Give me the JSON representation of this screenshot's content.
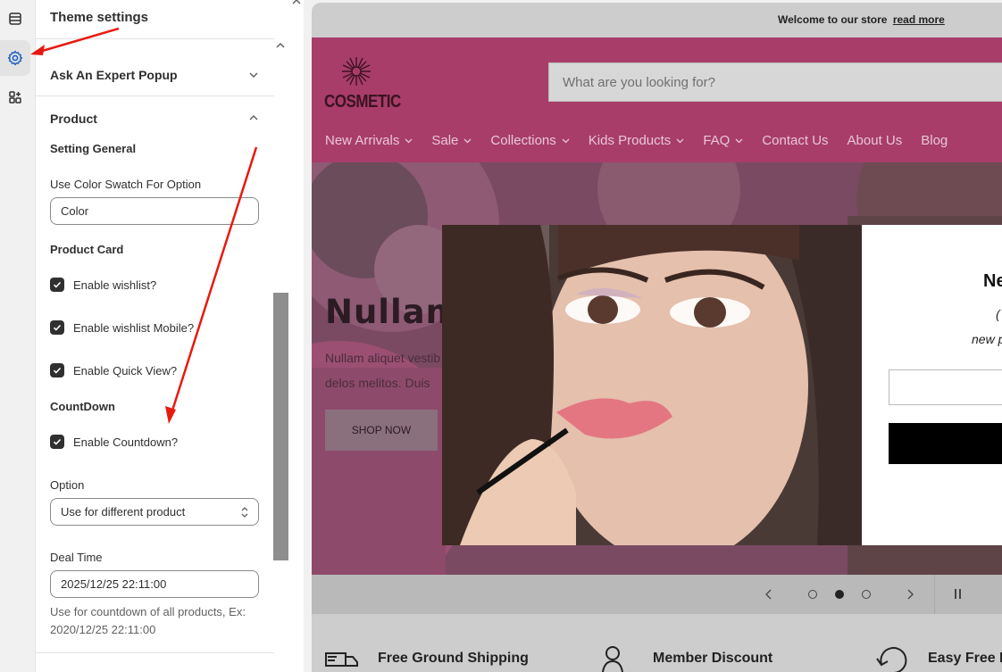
{
  "rail": {
    "icons": [
      "sections-icon",
      "settings-gear-icon",
      "apps-blocks-icon"
    ]
  },
  "panel": {
    "title": "Theme settings",
    "sections": {
      "ask_expert": "Ask An Expert Popup",
      "product": "Product"
    },
    "setting_general": "Setting General",
    "swatch_label": "Use Color Swatch For Option",
    "swatch_value": "Color",
    "product_card": "Product Card",
    "checks": {
      "wishlist": "Enable wishlist?",
      "wishlist_mobile": "Enable wishlist Mobile?",
      "quick_view": "Enable Quick View?"
    },
    "countdown_head": "CountDown",
    "countdown_check": "Enable Countdown?",
    "option_label": "Option",
    "option_value": "Use for different product",
    "deal_label": "Deal Time",
    "deal_value": "2025/12/25 22:11:00",
    "deal_help": "Use for countdown of all products, Ex: 2020/12/25 22:11:00"
  },
  "preview": {
    "announcement": "Welcome to our store",
    "announcement_link": "read more",
    "logo_text": "COSMETIC",
    "search_placeholder": "What are you looking for?",
    "nav": [
      "New Arrivals",
      "Sale",
      "Collections",
      "Kids Products",
      "FAQ",
      "Contact Us",
      "About Us",
      "Blog"
    ],
    "hero_title": "Nullam",
    "hero_text_1": "Nullam aliquet vestib",
    "hero_text_2": "delos melitos. Duis",
    "hero_button": "SHOP NOW",
    "popup_title": "Ne",
    "popup_sub1": "(",
    "popup_sub2": "new p",
    "features": [
      "Free Ground Shipping",
      "Member Discount",
      "Easy Free R"
    ]
  },
  "colors": {
    "header_bg": "#a83d6a",
    "arrow": "#e8190f",
    "checkbox": "#303030"
  }
}
